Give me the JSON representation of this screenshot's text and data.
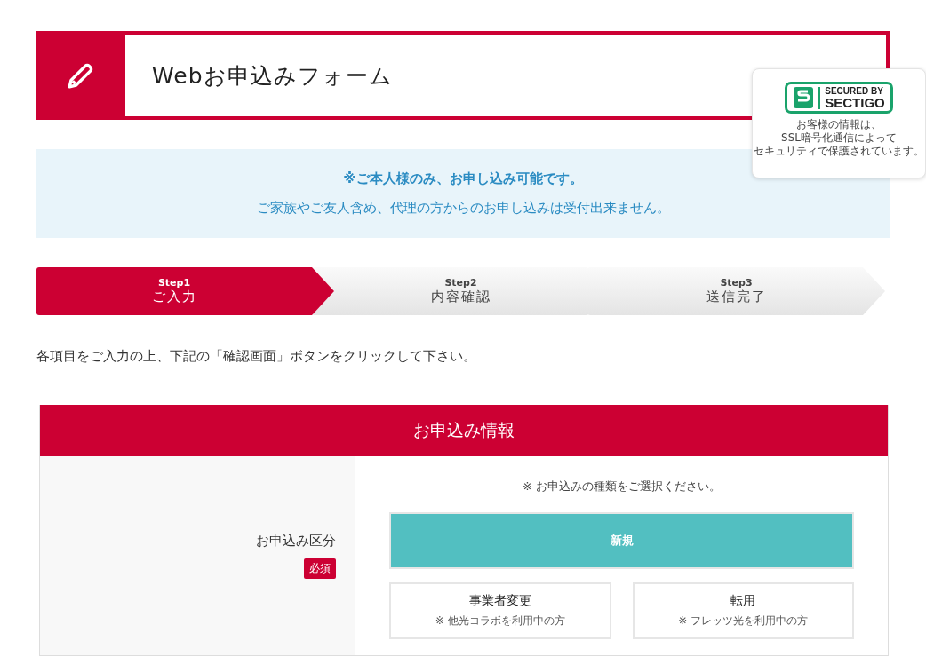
{
  "header": {
    "title": "Webお申込みフォーム"
  },
  "security_badge": {
    "line1": "SECURED BY",
    "line2": "SECTIGO",
    "caption": [
      "お客様の情報は、",
      "SSL暗号化通信によって",
      "セキュリティで保護されています。"
    ]
  },
  "notice": {
    "heading": "※ご本人様のみ、お申し込み可能です。",
    "text": "ご家族やご友人含め、代理の方からのお申し込みは受付出来ません。"
  },
  "steps": [
    {
      "label": "Step1",
      "name": "ご入力",
      "selected": true
    },
    {
      "label": "Step2",
      "name": "内容確認",
      "selected": false
    },
    {
      "label": "Step3",
      "name": "送信完了",
      "selected": false
    }
  ],
  "instruction": "各項目をご入力の上、下記の「確認画面」ボタンをクリックして下さい。",
  "form": {
    "title": "お申込み情報",
    "field_label": "お申込み区分",
    "required_badge": "必須",
    "hint": "※ お申込みの種類をご選択ください。",
    "options": [
      {
        "label": "新規",
        "selected": true
      },
      {
        "label": "事業者変更",
        "note": "※ 他光コラボを利用中の方",
        "selected": false
      },
      {
        "label": "転用",
        "note": "※ フレッツ光を利用中の方",
        "selected": false
      }
    ]
  }
}
